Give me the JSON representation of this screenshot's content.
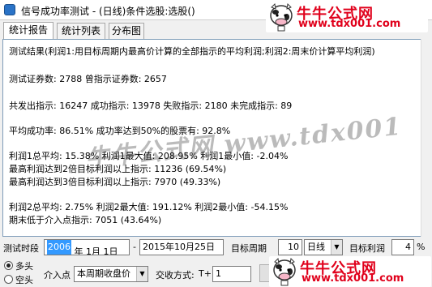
{
  "window": {
    "title": "信号成功率测试 - (日线)条件选股:选股()"
  },
  "logo": {
    "brand": "牛牛公式网",
    "url": "www.tdx001.com"
  },
  "tabs": [
    "统计报告",
    "统计列表",
    "分布图"
  ],
  "report": {
    "lines": [
      "测试结果(利润1:用目标周期内最高价计算的全部指示的平均利润;利润2:周末价计算平均利润)",
      "测试证券数:  2788            曾指示证券数:  2657",
      "共发出指示:  16247   成功指示:  13978   失败指示:  2180   未完成指示:  89",
      "平均成功率:  86.51%    成功率达到50%的股票有:  92.8%",
      "利润1总平均:  15.38%   利润1最大值:  208.95%   利润1最小值:  -2.04%",
      "最高利润达到2倍目标利润以上指示:  11236  (69.54%)",
      "最高利润达到3倍目标利润以上指示:  7970  (49.33%)",
      "利润2总平均:  2.75%   利润2最大值:  191.12%   利润2最小值:  -54.15%",
      "期末低于介入点指示:  7051  (43.64%)"
    ],
    "watermark": "牛牛公式网 www.tdx001"
  },
  "controls": {
    "period_label": "测试时段",
    "start_year": "2006",
    "start_rest": "年 1月 1日",
    "dash": "-",
    "end_date": "2015年10月25日",
    "target_period_label": "目标周期",
    "target_period_value": "10",
    "period_unit": "日线",
    "target_profit_label": "目标利润",
    "target_profit_value": "4",
    "target_profit_unit": "%",
    "radio_long": "多头",
    "radio_short": "空头",
    "entry_label": "介入点",
    "entry_value": "本周期收盘价",
    "trade_mode_label": "交收方式:",
    "trade_mode_prefix": "T+",
    "trade_mode_value": "1",
    "copy_label": "拷贝"
  }
}
